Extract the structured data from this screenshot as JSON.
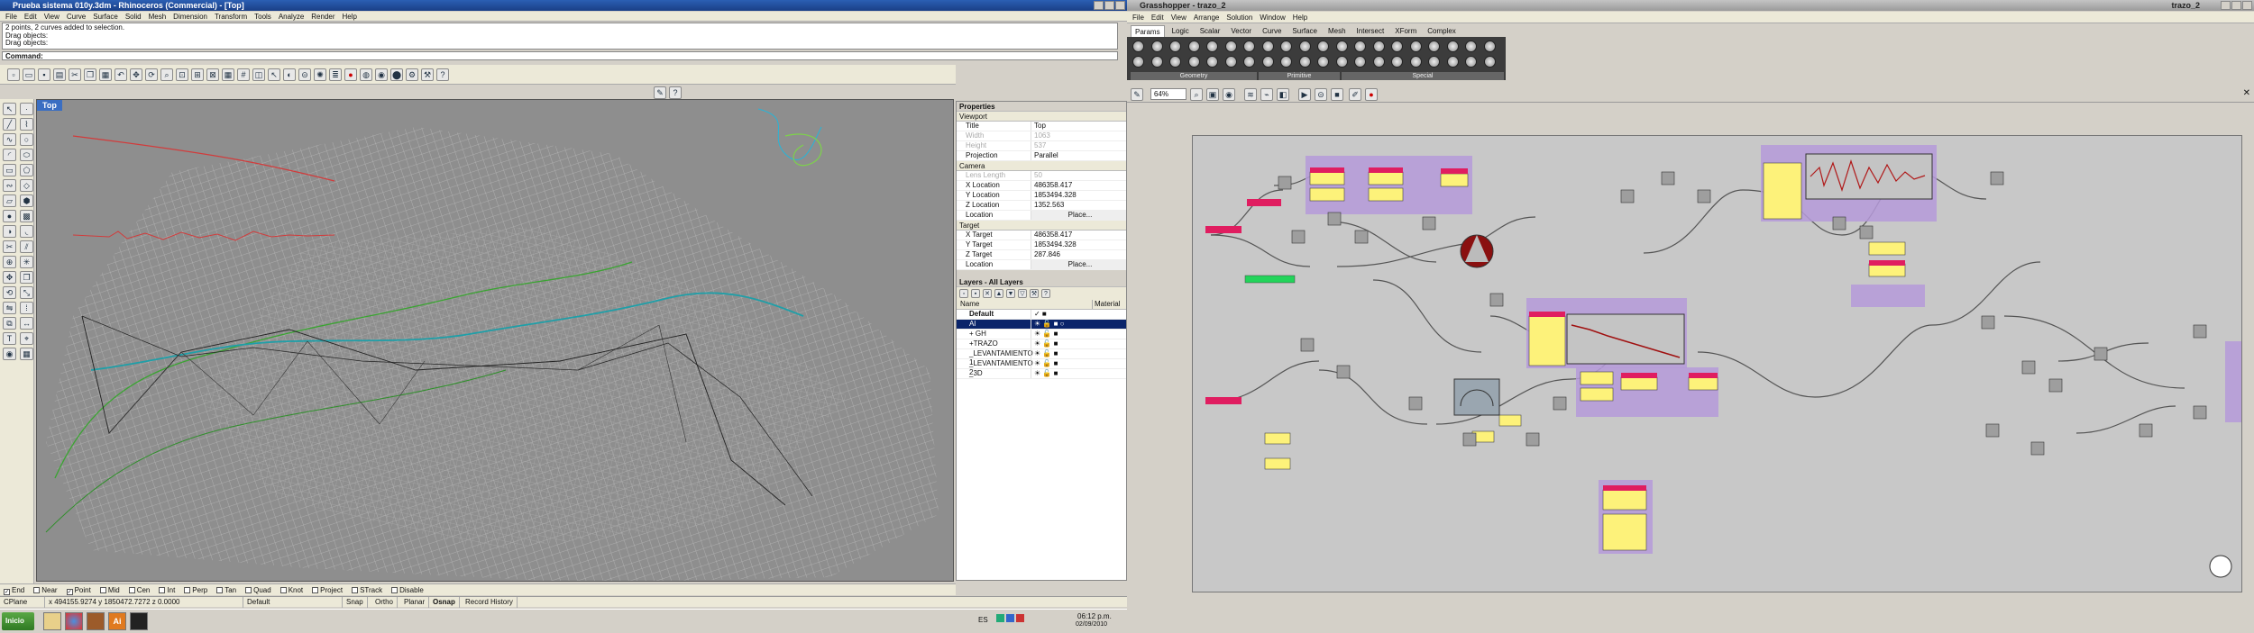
{
  "rhino": {
    "title": "Prueba sistema 010y.3dm - Rhinoceros (Commercial) - [Top]",
    "menu": [
      "File",
      "Edit",
      "View",
      "Curve",
      "Surface",
      "Solid",
      "Mesh",
      "Dimension",
      "Transform",
      "Tools",
      "Analyze",
      "Render",
      "Help"
    ],
    "history": [
      "2 points, 2 curves added to selection.",
      "Drag objects:",
      "Drag objects:"
    ],
    "command_label": "Command:",
    "viewport_title": "Top",
    "properties": {
      "header": "Properties",
      "viewport_section": "Viewport",
      "viewport_rows": [
        {
          "k": "Title",
          "v": "Top"
        },
        {
          "k": "Width",
          "v": "1063"
        },
        {
          "k": "Height",
          "v": "537"
        },
        {
          "k": "Projection",
          "v": "Parallel"
        }
      ],
      "camera_section": "Camera",
      "camera_rows": [
        {
          "k": "Lens Length",
          "v": "50"
        },
        {
          "k": "X Location",
          "v": "486358.417"
        },
        {
          "k": "Y Location",
          "v": "1853494.328"
        },
        {
          "k": "Z Location",
          "v": "1352.563"
        },
        {
          "k": "Location",
          "v": "Place..."
        }
      ],
      "target_section": "Target",
      "target_rows": [
        {
          "k": "X Target",
          "v": "486358.417"
        },
        {
          "k": "Y Target",
          "v": "1853494.328"
        },
        {
          "k": "Z Target",
          "v": "287.846"
        },
        {
          "k": "Location",
          "v": "Place..."
        }
      ]
    },
    "layers": {
      "header": "Layers - All Layers",
      "col_name": "Name",
      "col_material": "Material",
      "items": [
        "Default",
        "Al",
        "+ GH",
        "+TRAZO",
        "_LEVANTAMIENTO 1",
        "_LEVANTAMIENTO 2",
        "_3D"
      ]
    },
    "osnaps": [
      {
        "label": "End",
        "checked": true
      },
      {
        "label": "Near",
        "checked": false
      },
      {
        "label": "Point",
        "checked": true
      },
      {
        "label": "Mid",
        "checked": false
      },
      {
        "label": "Cen",
        "checked": false
      },
      {
        "label": "Int",
        "checked": false
      },
      {
        "label": "Perp",
        "checked": false
      },
      {
        "label": "Tan",
        "checked": false
      },
      {
        "label": "Quad",
        "checked": false
      },
      {
        "label": "Knot",
        "checked": false
      },
      {
        "label": "Project",
        "checked": false
      },
      {
        "label": "STrack",
        "checked": false
      },
      {
        "label": "Disable",
        "checked": false
      }
    ],
    "status": {
      "cplane": "CPlane",
      "coords": "x 494155.9274   y 1850472.7272   z 0.0000",
      "layer": "Default",
      "snap": "Snap",
      "ortho": "Ortho",
      "planar": "Planar",
      "osnap": "Osnap",
      "record": "Record History"
    }
  },
  "taskbar": {
    "start": "Inicio",
    "lang": "ES",
    "time": "06:12 p.m.",
    "date": "02/09/2010"
  },
  "gh": {
    "title": "Grasshopper - trazo_2",
    "right_title": "trazo_2",
    "menu": [
      "File",
      "Edit",
      "View",
      "Arrange",
      "Solution",
      "Window",
      "Help"
    ],
    "tabs": [
      "Params",
      "Logic",
      "Scalar",
      "Vector",
      "Curve",
      "Surface",
      "Mesh",
      "Intersect",
      "XForm",
      "Complex"
    ],
    "active_tab": "Params",
    "ribbon_groups": [
      "Geometry",
      "Primitive",
      "Special"
    ],
    "zoom": "64%"
  }
}
